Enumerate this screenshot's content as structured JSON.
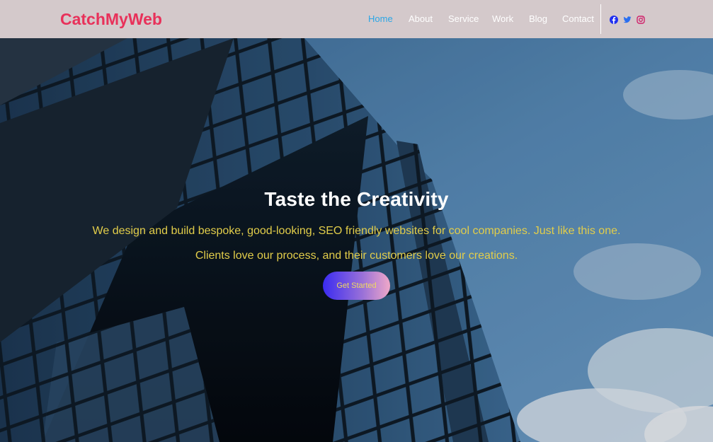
{
  "header": {
    "logo": "CatchMyWeb",
    "nav": [
      {
        "label": "Home",
        "active": true
      },
      {
        "label": "About",
        "active": false
      },
      {
        "label": "Service",
        "active": false
      },
      {
        "label": "Work",
        "active": false
      },
      {
        "label": "Blog",
        "active": false
      },
      {
        "label": "Contact",
        "active": false
      }
    ],
    "social": [
      {
        "icon": "facebook-icon",
        "color": "#1f2ff0"
      },
      {
        "icon": "twitter-icon",
        "color": "#2a6ef0"
      },
      {
        "icon": "instagram-icon",
        "color": "#d0216a"
      }
    ]
  },
  "hero": {
    "title": "Taste the Creativity",
    "text": "We design and build bespoke, good-looking, SEO friendly websites for cool companies. Just like this one. Clients love our process, and their customers love our creations.",
    "cta": "Get Started"
  },
  "colors": {
    "brand": "#e8315a",
    "nav_active": "#2ba6e6",
    "navbar_bg": "#d4c9cb",
    "hero_text": "#e2cd4a"
  }
}
